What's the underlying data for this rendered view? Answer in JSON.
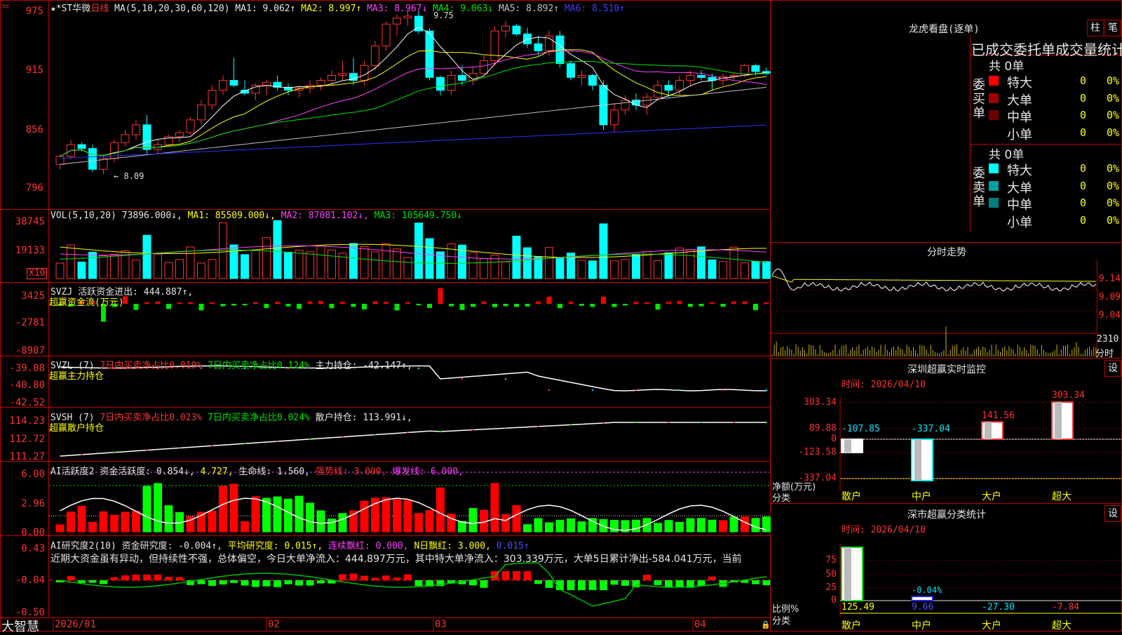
{
  "kline": {
    "header": {
      "title": "★*ST华微",
      "period": "日线",
      "ma_spec": "MA(5,10,20,30,60,120)",
      "ma": [
        {
          "label": "MA1:",
          "value": "9.062↑",
          "color": "#ffffff"
        },
        {
          "label": "MA2:",
          "value": "8.997↑",
          "color": "#ffff00"
        },
        {
          "label": "MA3:",
          "value": "8.967↓",
          "color": "#ff40ff"
        },
        {
          "label": "MA4:",
          "value": "9.063↓",
          "color": "#00e600"
        },
        {
          "label": "MA5:",
          "value": "8.892↑",
          "color": "#c0c0c0"
        },
        {
          "label": "MA6:",
          "value": "8.510↑",
          "color": "#4040ff"
        }
      ]
    },
    "y_ticks": [
      "975",
      "915",
      "856",
      "796"
    ],
    "marker_high": "9.75",
    "marker_low": "← 8.09",
    "candles": [
      [
        8.2,
        8.3,
        8.15,
        8.28
      ],
      [
        8.28,
        8.45,
        8.25,
        8.4
      ],
      [
        8.4,
        8.42,
        8.33,
        8.36
      ],
      [
        8.36,
        8.4,
        8.12,
        8.15
      ],
      [
        8.15,
        8.3,
        8.1,
        8.26
      ],
      [
        8.26,
        8.45,
        8.22,
        8.42
      ],
      [
        8.42,
        8.55,
        8.38,
        8.5
      ],
      [
        8.5,
        8.65,
        8.45,
        8.6
      ],
      [
        8.6,
        8.7,
        8.3,
        8.35
      ],
      [
        8.35,
        8.45,
        8.3,
        8.4
      ],
      [
        8.4,
        8.5,
        8.38,
        8.48
      ],
      [
        8.48,
        8.55,
        8.42,
        8.52
      ],
      [
        8.52,
        8.68,
        8.5,
        8.65
      ],
      [
        8.65,
        8.85,
        8.6,
        8.8
      ],
      [
        8.8,
        9.0,
        8.75,
        8.95
      ],
      [
        8.95,
        9.1,
        8.9,
        9.05
      ],
      [
        9.05,
        9.28,
        8.98,
        9.0
      ],
      [
        8.95,
        9.05,
        8.9,
        8.92
      ],
      [
        8.92,
        9.02,
        8.85,
        9.0
      ],
      [
        9.0,
        9.05,
        8.9,
        9.03
      ],
      [
        9.03,
        9.1,
        8.95,
        8.98
      ],
      [
        8.98,
        9.02,
        8.9,
        8.95
      ],
      [
        8.95,
        9.0,
        8.88,
        8.97
      ],
      [
        8.97,
        9.05,
        8.92,
        9.0
      ],
      [
        9.0,
        9.08,
        8.95,
        9.05
      ],
      [
        9.05,
        9.15,
        9.0,
        9.1
      ],
      [
        9.1,
        9.25,
        9.05,
        9.12
      ],
      [
        9.12,
        9.28,
        9.0,
        9.05
      ],
      [
        9.05,
        9.25,
        9.0,
        9.2
      ],
      [
        9.2,
        9.45,
        9.15,
        9.4
      ],
      [
        9.4,
        9.65,
        9.35,
        9.62
      ],
      [
        9.62,
        9.72,
        9.5,
        9.68
      ],
      [
        9.68,
        9.75,
        9.6,
        9.7
      ],
      [
        9.7,
        9.75,
        9.52,
        9.55
      ],
      [
        9.55,
        9.58,
        9.05,
        9.08
      ],
      [
        9.08,
        9.1,
        8.9,
        8.95
      ],
      [
        8.95,
        9.15,
        8.9,
        9.1
      ],
      [
        9.1,
        9.2,
        9.0,
        9.05
      ],
      [
        9.05,
        9.18,
        9.0,
        9.12
      ],
      [
        9.12,
        9.3,
        9.1,
        9.25
      ],
      [
        9.25,
        9.6,
        9.2,
        9.55
      ],
      [
        9.55,
        9.65,
        9.48,
        9.6
      ],
      [
        9.6,
        9.62,
        9.5,
        9.52
      ],
      [
        9.52,
        9.58,
        9.38,
        9.42
      ],
      [
        9.42,
        9.5,
        9.3,
        9.35
      ],
      [
        9.35,
        9.55,
        9.3,
        9.5
      ],
      [
        9.5,
        9.55,
        9.18,
        9.22
      ],
      [
        9.22,
        9.25,
        9.05,
        9.08
      ],
      [
        9.08,
        9.15,
        9.0,
        9.1
      ],
      [
        9.1,
        9.12,
        8.95,
        9.0
      ],
      [
        9.0,
        9.05,
        8.55,
        8.6
      ],
      [
        8.6,
        8.82,
        8.52,
        8.75
      ],
      [
        8.75,
        8.9,
        8.7,
        8.85
      ],
      [
        8.85,
        8.92,
        8.75,
        8.8
      ],
      [
        8.8,
        8.92,
        8.7,
        8.88
      ],
      [
        8.88,
        9.05,
        8.85,
        9.0
      ],
      [
        9.0,
        9.05,
        8.88,
        8.95
      ],
      [
        8.95,
        9.1,
        8.9,
        9.05
      ],
      [
        9.05,
        9.15,
        9.0,
        9.1
      ],
      [
        9.1,
        9.15,
        9.05,
        9.08
      ],
      [
        9.08,
        9.12,
        8.95,
        9.05
      ],
      [
        9.05,
        9.12,
        9.0,
        9.09
      ],
      [
        9.09,
        9.12,
        9.05,
        9.1
      ],
      [
        9.1,
        9.22,
        9.08,
        9.2
      ],
      [
        9.2,
        9.22,
        9.1,
        9.14
      ],
      [
        9.14,
        9.18,
        9.1,
        9.12
      ]
    ]
  },
  "vol": {
    "header": [
      {
        "text": "VOL(5,10,20)",
        "color": "#e6e6e6"
      },
      {
        "text": "73896.000↓,",
        "color": "#e6e6e6"
      },
      {
        "text": "MA1: 85509.000↓,",
        "color": "#ffff00"
      },
      {
        "text": "MA2: 87081.102↓,",
        "color": "#ff40ff"
      },
      {
        "text": "MA3: 105649.750↓",
        "color": "#00e600"
      }
    ],
    "y_ticks": [
      "38745",
      "19133"
    ],
    "unit": "X10"
  },
  "svzj": {
    "header": [
      {
        "text": "SVZJ  活跃资金进出: 444.887↑,",
        "color": "#e6e6e6"
      }
    ],
    "sub": "超赢资金流(万元)",
    "y_ticks": [
      "3425",
      "-2781",
      "-8987"
    ]
  },
  "svzl": {
    "header": [
      {
        "text": "SVZL (7)",
        "color": "#e6e6e6"
      },
      {
        "text": "7日内买卖净占比0.019%",
        "color": "#ff3232"
      },
      {
        "text": "7日内买卖净占比0.124%",
        "color": "#00e600"
      },
      {
        "text": "主力持仓: -42.147↑,",
        "color": "#e6e6e6"
      }
    ],
    "sub": "超赢主力持仓",
    "y_ticks": [
      "-39.08",
      "-40.80",
      "-42.52"
    ]
  },
  "svsh": {
    "header": [
      {
        "text": "SVSH (7)",
        "color": "#e6e6e6"
      },
      {
        "text": "7日内买卖净占比0.023%",
        "color": "#ff3232"
      },
      {
        "text": "7日内买卖净占比0.024%",
        "color": "#00e600"
      },
      {
        "text": "散户持仓: 113.991↓,",
        "color": "#e6e6e6"
      }
    ],
    "sub": "超赢散户持仓",
    "y_ticks": [
      "114.23",
      "112.72",
      "111.27"
    ]
  },
  "ai1": {
    "header": [
      {
        "text": "AI活跃度2",
        "color": "#e6e6e6"
      },
      {
        "text": "资金活跃度: 0.854↓,",
        "color": "#e6e6e6"
      },
      {
        "text": "4.727,",
        "color": "#ffff00"
      },
      {
        "text": "生命线: 1.560,",
        "color": "#e6e6e6"
      },
      {
        "text": "强势线: 3.000,",
        "color": "#ff3232"
      },
      {
        "text": "爆发线: 6.000,",
        "color": "#ff40ff"
      }
    ],
    "y_ticks": [
      "6.00",
      "2.96",
      "0.00"
    ]
  },
  "ai2": {
    "header": [
      {
        "text": "AI研究度2(10)",
        "color": "#e6e6e6"
      },
      {
        "text": "资金研究度: -0.004↑,",
        "color": "#e6e6e6"
      },
      {
        "text": "平均研究度: 0.015↑,",
        "color": "#ffff00"
      },
      {
        "text": "连续飘红: 0.000,",
        "color": "#ff40ff"
      },
      {
        "text": "N日飘红: 3.000,",
        "color": "#ffff00"
      },
      {
        "text": "0.015↑",
        "color": "#5050ff"
      }
    ],
    "comment": "近期大资金虽有异动，但持续性不强，总体偏空，今日大单净流入：444.897万元，其中特大单净流入：303.339万元，大单5日累计净出-584.041万元，当前",
    "y_ticks": [
      "0.43",
      "-0.04",
      "-0.50"
    ]
  },
  "xaxis": {
    "brand": "大智慧",
    "labels": [
      "2026/01",
      "02",
      "03",
      "04"
    ]
  },
  "dragon": {
    "title": "龙虎看盘(逐单)",
    "btn_bar": "柱",
    "btn_line": "笔",
    "header": "已成交委托单成交量统计",
    "buy": {
      "side": "委买单",
      "total": "共 0单",
      "rows": [
        {
          "name": "特大",
          "v": "0",
          "p": "0%",
          "color": "#ff0000"
        },
        {
          "name": "大单",
          "v": "0",
          "p": "0%",
          "color": "#a00000"
        },
        {
          "name": "中单",
          "v": "0",
          "p": "0%",
          "color": "#700000"
        },
        {
          "name": "小单",
          "v": "0",
          "p": "0%",
          "color": "#000000"
        }
      ]
    },
    "sell": {
      "side": "委卖单",
      "total": "共 0单",
      "rows": [
        {
          "name": "特大",
          "v": "0",
          "p": "0%",
          "color": "#00ffff"
        },
        {
          "name": "大单",
          "v": "0",
          "p": "0%",
          "color": "#00a0a0"
        },
        {
          "name": "中单",
          "v": "0",
          "p": "0%",
          "color": "#008080"
        },
        {
          "name": "小单",
          "v": "0",
          "p": "0%",
          "color": "#000000"
        }
      ]
    }
  },
  "intraday": {
    "title": "分时走势",
    "y_ticks": [
      "9.14",
      "9.09",
      "9.04"
    ],
    "vol_label": "2310",
    "vol_unit": "分时"
  },
  "monitor": {
    "title": "深圳超赢实时监控",
    "btn": "设",
    "time": "时间: 2026/04/10",
    "y_ticks": [
      "303.34",
      "89.88",
      "0",
      "-123.58",
      "-337.04"
    ],
    "ylabel": "净额(万元)",
    "xlabel": "分类",
    "chart_data": {
      "type": "bar",
      "categories": [
        "散户",
        "中户",
        "大户",
        "超大"
      ],
      "values": [
        -107.85,
        -337.04,
        141.56,
        303.34
      ]
    }
  },
  "classstat": {
    "title": "深市超赢分类统计",
    "btn": "设",
    "time": "时间: 2026/04/10",
    "y_ticks": [
      "75",
      "50",
      "25",
      "0"
    ],
    "ylabel": "比例%",
    "xlabel": "分类",
    "chart_data": {
      "type": "bar",
      "categories": [
        "散户",
        "中户",
        "大户",
        "超大"
      ],
      "values": [
        125.49,
        9.66,
        -27.3,
        -7.84
      ],
      "annotation": "-0.04%"
    }
  }
}
